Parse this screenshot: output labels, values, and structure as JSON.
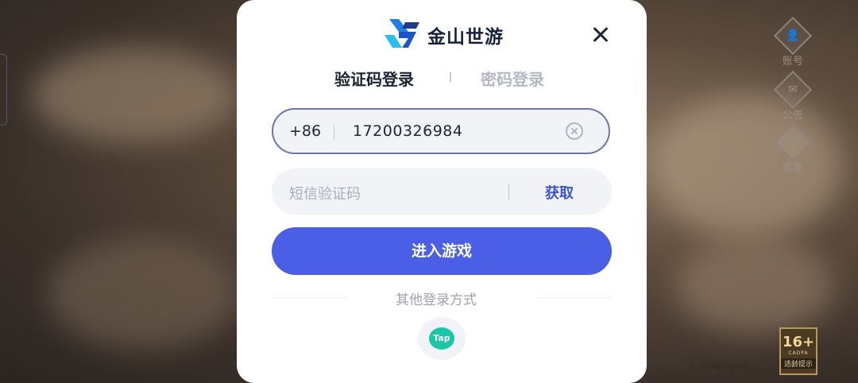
{
  "background": {
    "side_buttons": [
      {
        "label": "账号",
        "icon": "account-icon"
      },
      {
        "label": "公告",
        "icon": "notice-icon"
      },
      {
        "label": "客服",
        "icon": "support-icon"
      }
    ],
    "age_badge": {
      "rating": "16+",
      "org": "CADPA",
      "tip": "适龄提示"
    },
    "version": "1.10.4@taptap"
  },
  "modal": {
    "brand_name": "金山世游",
    "tabs": [
      {
        "label": "验证码登录",
        "active": true
      },
      {
        "label": "密码登录",
        "active": false
      }
    ],
    "phone": {
      "country_code": "+86",
      "value": "17200326984"
    },
    "code": {
      "placeholder": "短信验证码",
      "get_code_label": "获取"
    },
    "enter_button": "进入游戏",
    "other_login_label": "其他登录方式",
    "other_login": [
      {
        "label": "Tap",
        "icon": "taptap-icon",
        "color": "#19c7a6"
      }
    ]
  },
  "colors": {
    "accent": "#4a5fe6",
    "link": "#3a55d8",
    "brand_dark": "#15203a"
  }
}
